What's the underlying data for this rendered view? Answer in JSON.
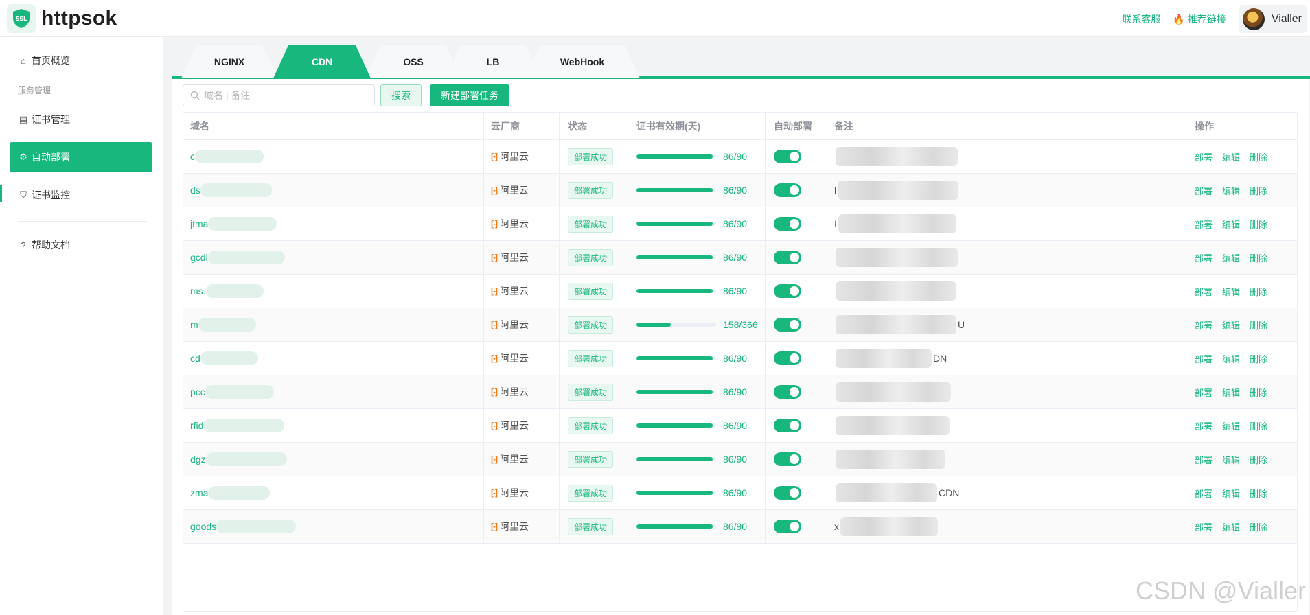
{
  "app": {
    "name": "httpsok",
    "logo_text": "SSL"
  },
  "header": {
    "contact_label": "联系客服",
    "recommend_label": "推荐链接",
    "user_name": "Vialler"
  },
  "sidebar": {
    "group_label": "服务管理",
    "items": [
      {
        "label": "首页概览",
        "icon": "home-icon"
      },
      {
        "label": "证书管理",
        "icon": "certificate-icon"
      },
      {
        "label": "自动部署",
        "icon": "deploy-icon",
        "active": true
      },
      {
        "label": "证书监控",
        "icon": "shield-icon"
      },
      {
        "label": "帮助文档",
        "icon": "help-icon"
      }
    ]
  },
  "tabs": [
    {
      "label": "NGINX"
    },
    {
      "label": "CDN",
      "active": true
    },
    {
      "label": "OSS"
    },
    {
      "label": "LB"
    },
    {
      "label": "WebHook"
    }
  ],
  "toolbar": {
    "search_placeholder": "域名 | 备注",
    "search_button": "搜索",
    "new_task_button": "新建部署任务"
  },
  "table": {
    "columns": [
      "域名",
      "云厂商",
      "状态",
      "证书有效期(天)",
      "自动部署",
      "备注",
      "操作"
    ],
    "ops": [
      "部署",
      "编辑",
      "删除"
    ],
    "rows": [
      {
        "domain": "c",
        "vendor": "阿里云",
        "status": "部署成功",
        "validity": "86/90",
        "progress": 0.956,
        "note_prefix": "",
        "note_suffix": ""
      },
      {
        "domain": "ds",
        "vendor": "阿里云",
        "status": "部署成功",
        "validity": "86/90",
        "progress": 0.956,
        "note_prefix": "l",
        "note_suffix": ""
      },
      {
        "domain": "jtma",
        "vendor": "阿里云",
        "status": "部署成功",
        "validity": "86/90",
        "progress": 0.956,
        "note_prefix": "I",
        "note_suffix": ""
      },
      {
        "domain": "gcdi",
        "vendor": "阿里云",
        "status": "部署成功",
        "validity": "86/90",
        "progress": 0.956,
        "note_prefix": "",
        "note_suffix": ""
      },
      {
        "domain": "ms.",
        "vendor": "阿里云",
        "status": "部署成功",
        "validity": "86/90",
        "progress": 0.956,
        "note_prefix": "",
        "note_suffix": ""
      },
      {
        "domain": "m",
        "vendor": "阿里云",
        "status": "部署成功",
        "validity": "158/366",
        "progress": 0.432,
        "note_prefix": "",
        "note_suffix": "U"
      },
      {
        "domain": "cd",
        "vendor": "阿里云",
        "status": "部署成功",
        "validity": "86/90",
        "progress": 0.956,
        "note_prefix": "",
        "note_suffix": "DN"
      },
      {
        "domain": "pcc",
        "vendor": "阿里云",
        "status": "部署成功",
        "validity": "86/90",
        "progress": 0.956,
        "note_prefix": "",
        "note_suffix": ""
      },
      {
        "domain": "rfid",
        "vendor": "阿里云",
        "status": "部署成功",
        "validity": "86/90",
        "progress": 0.956,
        "note_prefix": "",
        "note_suffix": ""
      },
      {
        "domain": "dgz",
        "vendor": "阿里云",
        "status": "部署成功",
        "validity": "86/90",
        "progress": 0.956,
        "note_prefix": "",
        "note_suffix": ""
      },
      {
        "domain": "zma",
        "vendor": "阿里云",
        "status": "部署成功",
        "validity": "86/90",
        "progress": 0.956,
        "note_prefix": "",
        "note_suffix": "CDN"
      },
      {
        "domain": "goods",
        "vendor": "阿里云",
        "status": "部署成功",
        "validity": "86/90",
        "progress": 0.956,
        "note_prefix": "x",
        "note_suffix": ""
      }
    ]
  },
  "watermark": "CSDN @Vialler",
  "colors": {
    "accent": "#17b77e",
    "vendor": "#f27b1a"
  }
}
